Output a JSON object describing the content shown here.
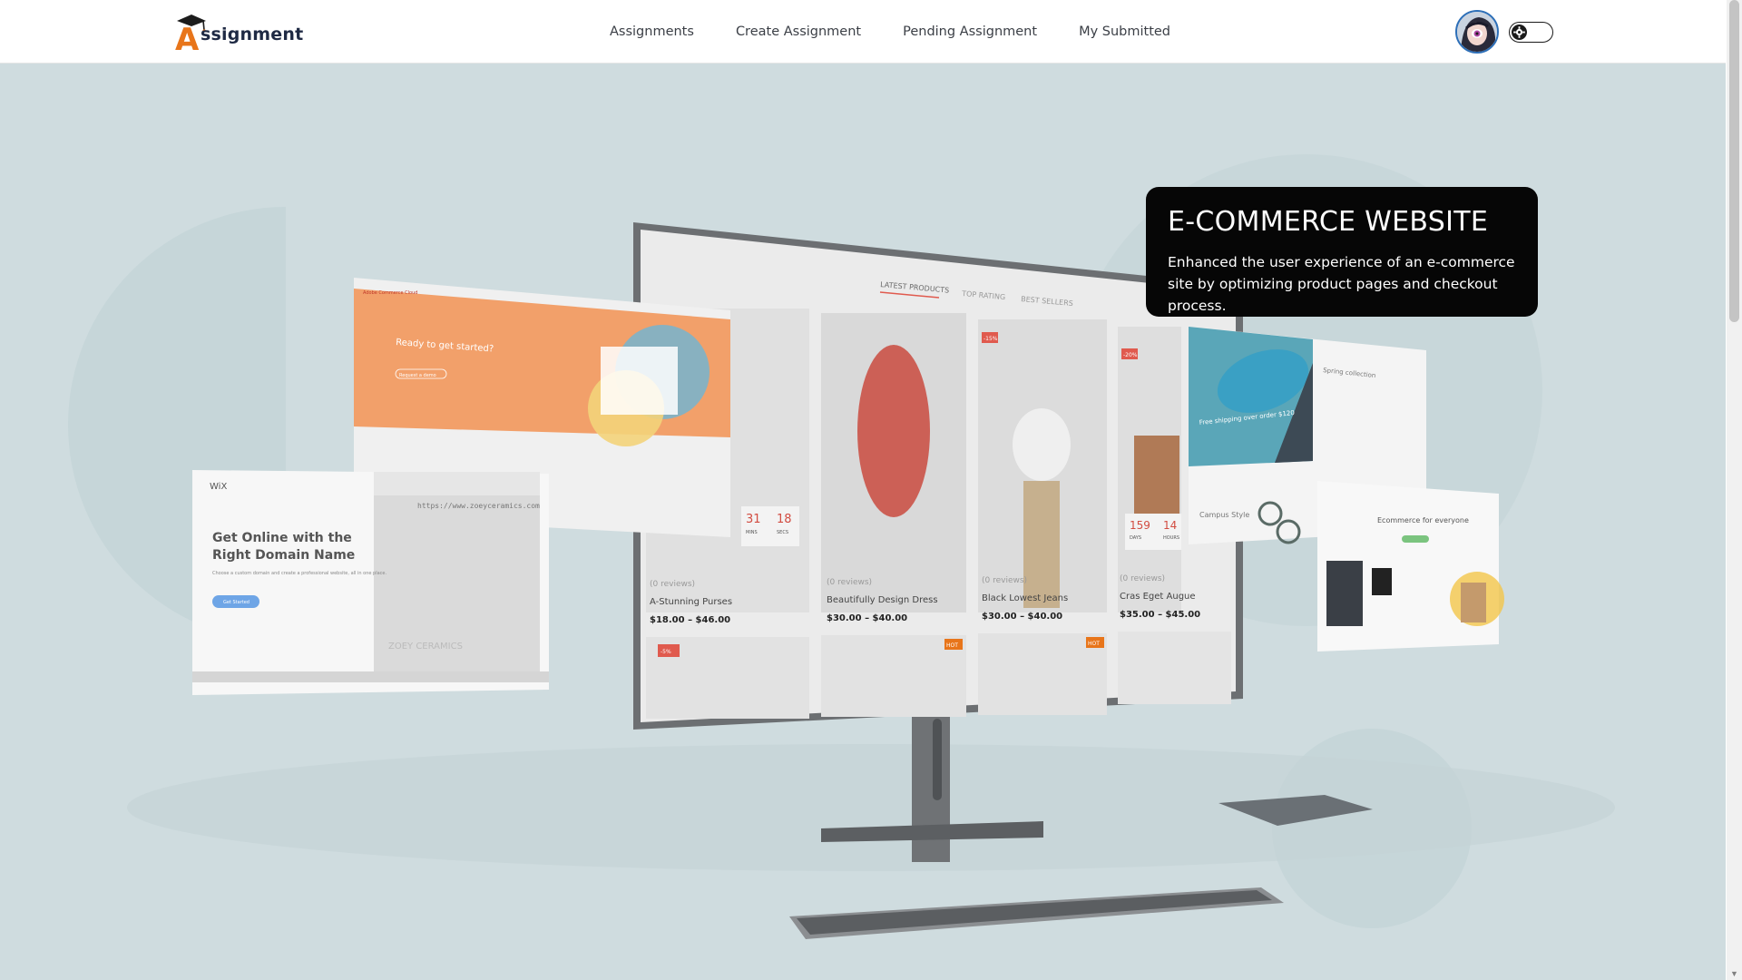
{
  "navbar": {
    "logo": {
      "letter": "A",
      "text": "ssignment"
    },
    "links": [
      {
        "label": "Assignments"
      },
      {
        "label": "Create Assignment"
      },
      {
        "label": "Pending Assignment"
      },
      {
        "label": "My Submitted"
      }
    ],
    "theme_toggle_icon": "gear-icon"
  },
  "hero": {
    "card": {
      "title": "E-COMMERCE WEBSITE",
      "description": "Enhanced the user experience of an e-commerce site by optimizing product pages and checkout process."
    },
    "monitor": {
      "tabs": [
        "LATEST PRODUCTS",
        "TOP RATING",
        "BEST SELLERS"
      ],
      "products": [
        {
          "name": "A-Stunning Purses",
          "price": "$18.00 – $46.00",
          "reviews": "(0 reviews)"
        },
        {
          "name": "Beautifully Design Dress",
          "price": "$30.00 – $40.00",
          "reviews": "(0 reviews)"
        },
        {
          "name": "Black Lowest Jeans",
          "price": "$30.00 – $40.00",
          "reviews": "(0 reviews)"
        },
        {
          "name": "Cras Eget Augue",
          "price": "$35.00 – $45.00",
          "reviews": "(0 reviews)"
        }
      ],
      "countdown": [
        {
          "value": "31",
          "unit": "MINS"
        },
        {
          "value": "18",
          "unit": "SECS"
        },
        {
          "value": "159",
          "unit": "DAYS"
        },
        {
          "value": "14",
          "unit": "HOURS"
        }
      ],
      "badges": [
        "-15%",
        "-20%",
        "HOT",
        "HOT",
        "-5%"
      ]
    },
    "wix_screen": {
      "logo": "WiX",
      "heading_line1": "Get Online with the",
      "heading_line2": "Right Domain Name",
      "subtext": "Choose a custom domain and create a professional website, all in one place.",
      "button": "Get Started",
      "url": "https://www.zoeyceramics.com",
      "brand": "ZOEY CERAMICS"
    },
    "adobe_screen": {
      "brand": "Adobe Commerce Cloud",
      "heading": "Ready to get started?",
      "cta": "Request a demo"
    },
    "promo_panel": {
      "shipping": "Free shipping over order $120",
      "spring": "Spring collection",
      "campus": "Campus Style"
    },
    "shop_screen": {
      "heading": "Ecommerce for everyone"
    }
  },
  "colors": {
    "accent": "#e8751a",
    "hero_bg": "#cfdcdf",
    "card_bg": "#060606",
    "avatar_border": "#2d6fb8"
  }
}
